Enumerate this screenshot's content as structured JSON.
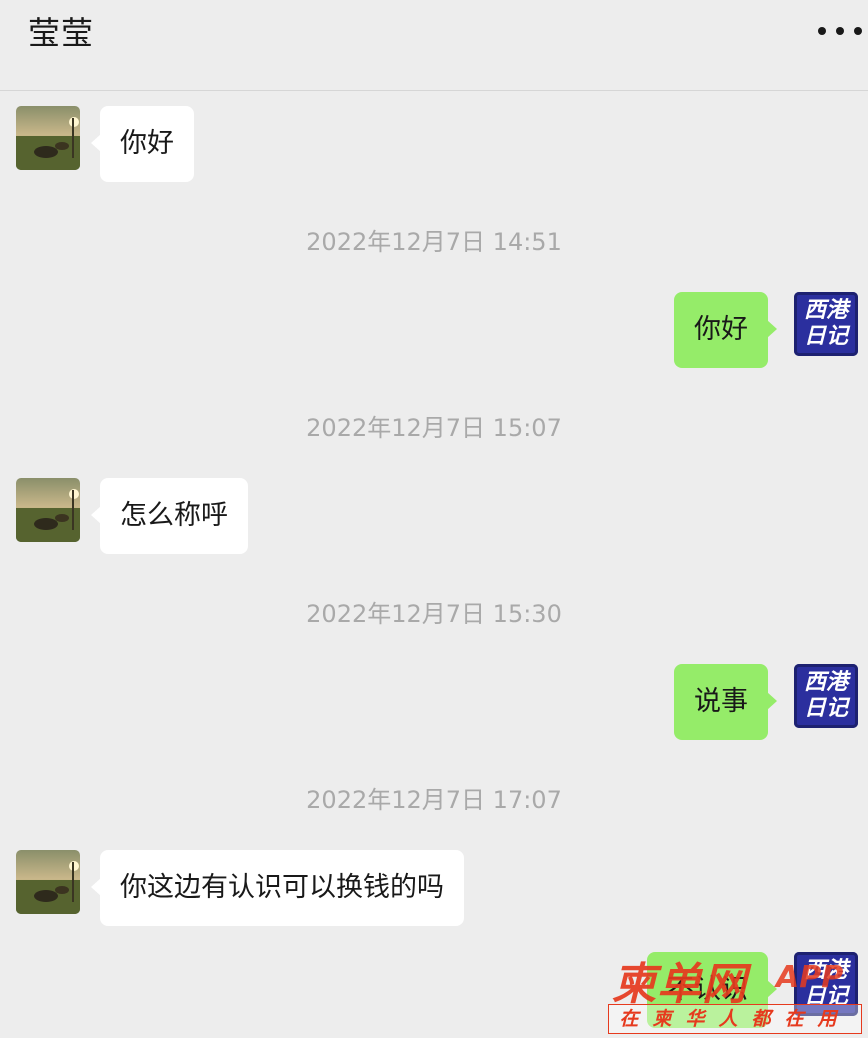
{
  "header": {
    "title": "莹莹",
    "more_icon": "more-dots-icon"
  },
  "avatars": {
    "contact": "landscape-photo-avatar",
    "self": {
      "line1": "西港",
      "line2": "日记"
    }
  },
  "messages": [
    {
      "side": "left",
      "text": "你好"
    },
    {
      "timestamp": "2022年12月7日 14:51"
    },
    {
      "side": "right",
      "text": "你好"
    },
    {
      "timestamp": "2022年12月7日 15:07"
    },
    {
      "side": "left",
      "text": "怎么称呼"
    },
    {
      "timestamp": "2022年12月7日 15:30"
    },
    {
      "side": "right",
      "text": "说事"
    },
    {
      "timestamp": "2022年12月7日 17:07"
    },
    {
      "side": "left",
      "text": "你这边有认识可以换钱的吗"
    },
    {
      "side": "right",
      "text": "不认识"
    }
  ],
  "watermark": {
    "title": "柬单网",
    "suffix": "APP",
    "slogan": "在柬华人都在用"
  },
  "colors": {
    "background": "#ededed",
    "bubble_self": "#95ec69",
    "bubble_other": "#ffffff",
    "timestamp": "#a9a9a9",
    "watermark": "#e63a1e",
    "self_avatar": "#2b2f9e"
  }
}
